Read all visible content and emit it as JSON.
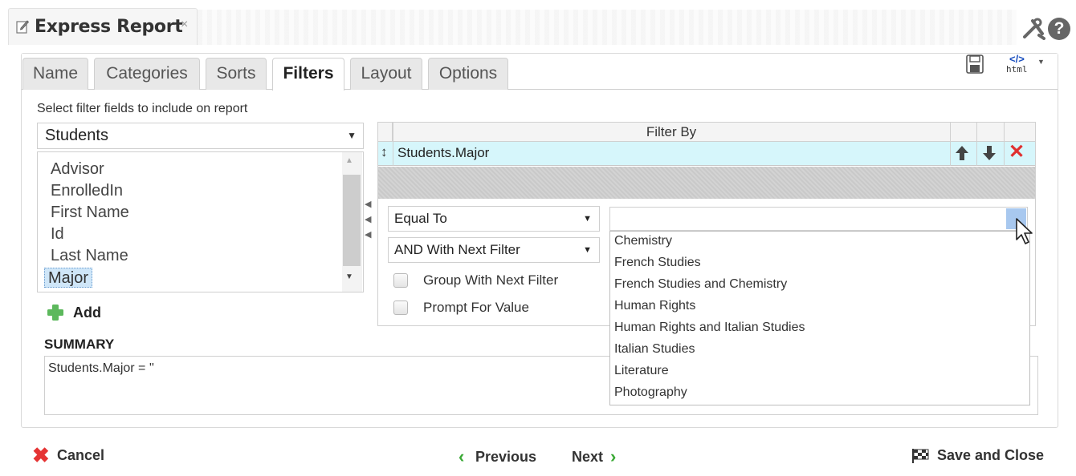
{
  "window": {
    "title": "Express Report",
    "close_glyph": "×",
    "help_glyph": "?"
  },
  "tabs": [
    {
      "label": "Name",
      "active": false
    },
    {
      "label": "Categories",
      "active": false
    },
    {
      "label": "Sorts",
      "active": false
    },
    {
      "label": "Filters",
      "active": true
    },
    {
      "label": "Layout",
      "active": false
    },
    {
      "label": "Options",
      "active": false
    }
  ],
  "toolbar": {
    "html_label_top": "</>",
    "html_label_bottom": "html"
  },
  "fields_panel": {
    "instruction": "Select filter fields to include on report",
    "table_select": "Students",
    "fields": [
      "Advisor",
      "EnrolledIn",
      "First Name",
      "Id",
      "Last Name",
      "Major"
    ],
    "selected_field": "Major",
    "add_label": "Add"
  },
  "filter_grid": {
    "header": "Filter By",
    "rows": [
      {
        "field": "Students.Major"
      }
    ],
    "operator": "Equal To",
    "join": "AND With Next Filter",
    "group_with_next_label": "Group With Next Filter",
    "group_with_next_checked": false,
    "prompt_for_value_label": "Prompt For Value",
    "prompt_for_value_checked": false,
    "value": "",
    "value_options": [
      "Chemistry",
      "French Studies",
      "French Studies and Chemistry",
      "Human Rights",
      "Human Rights and Italian Studies",
      "Italian Studies",
      "Literature",
      "Photography"
    ]
  },
  "summary": {
    "label": "SUMMARY",
    "text": "Students.Major = ''"
  },
  "footer": {
    "cancel_label": "Cancel",
    "previous_label": "Previous",
    "next_label": "Next",
    "save_close_label": "Save and Close"
  },
  "colors": {
    "selected_row": "#d6f6fb",
    "selected_list_item": "#cfe6f8",
    "delete_red": "#e03030",
    "nav_green": "#3aa935",
    "add_green": "#5cb85c"
  },
  "icons": [
    "edit-icon",
    "close-icon",
    "tools-icon",
    "help-icon",
    "save-icon",
    "html-code-icon",
    "plus-icon",
    "move-handle-icon",
    "arrow-up-icon",
    "arrow-down-icon",
    "delete-icon",
    "cancel-icon",
    "chevron-left-icon",
    "chevron-right-icon",
    "checkered-flag-icon"
  ]
}
